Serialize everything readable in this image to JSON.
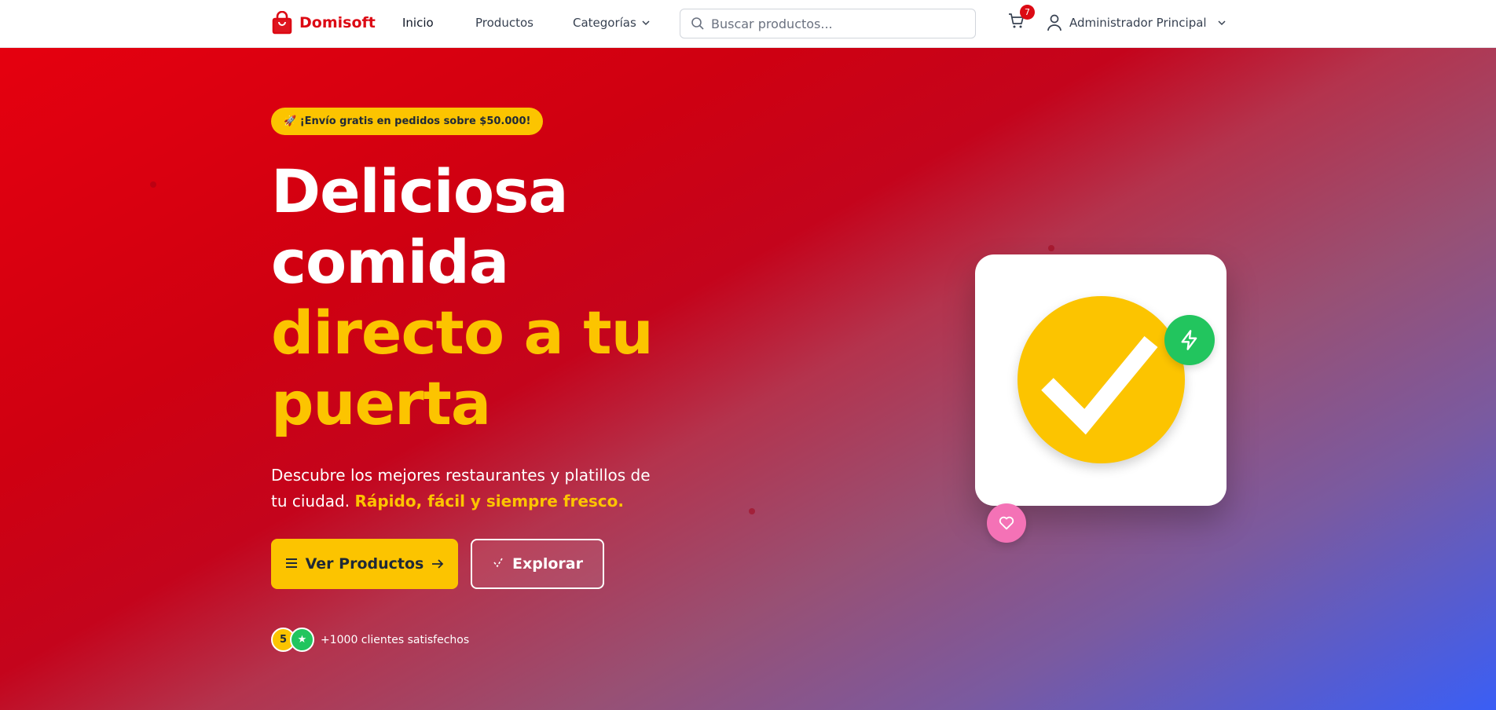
{
  "header": {
    "brand": "Domisoft",
    "nav": {
      "inicio": "Inicio",
      "productos": "Productos",
      "categorias": "Categorías"
    },
    "search_placeholder": "Buscar productos...",
    "cart_count": "7",
    "user_name": "Administrador Principal"
  },
  "hero": {
    "promo": "🚀 ¡Envío gratis en pedidos sobre $50.000!",
    "title_line1": "Deliciosa",
    "title_line2": "comida",
    "title_line3": "directo a tu",
    "title_line4": "puerta",
    "description": "Descubre los mejores restaurantes y platillos de tu ciudad.",
    "description_highlight": "Rápido, fácil y siempre fresco.",
    "primary_button": "Ver Productos",
    "secondary_button": "Explorar",
    "rating_badge": "5",
    "rating_star": "★",
    "social_proof": "+1000 clientes satisfechos"
  },
  "colors": {
    "brand_red": "#dc0a14",
    "accent_yellow": "#fcc400",
    "success_green": "#22c55e",
    "pink": "#f472b6"
  },
  "icons": [
    "shopping-bag-icon",
    "chevron-down-icon",
    "search-icon",
    "cart-icon",
    "user-icon",
    "menu-icon",
    "arrow-right-icon",
    "compass-icon",
    "check-icon",
    "bolt-icon",
    "heart-icon"
  ]
}
